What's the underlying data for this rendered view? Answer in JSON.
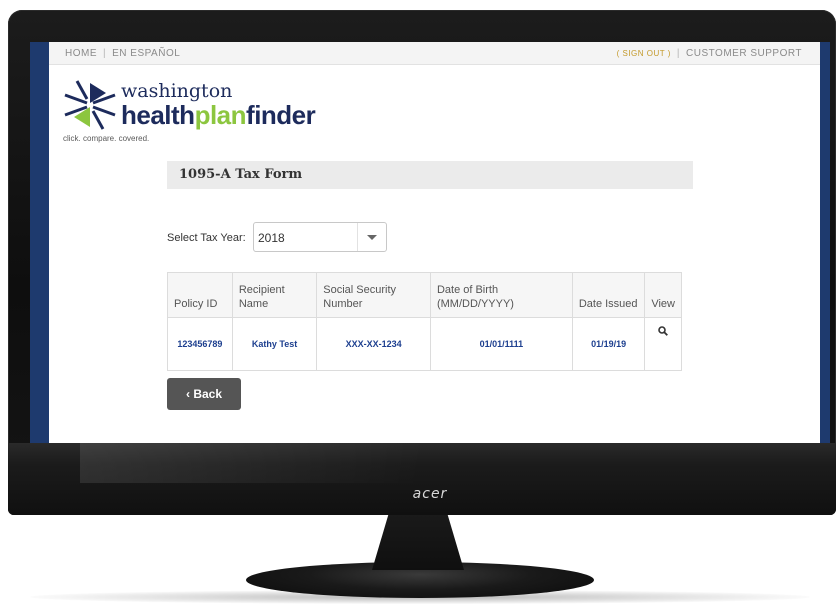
{
  "nav": {
    "home": "HOME",
    "espanol": "EN ESPAÑOL",
    "signout": "( SIGN OUT )",
    "support": "CUSTOMER SUPPORT"
  },
  "logo": {
    "line1": "washington",
    "hp_a": "health",
    "hp_b": "plan",
    "hp_c": "finder",
    "tagline": "click. compare. covered."
  },
  "page": {
    "title": "1095-A Tax Form",
    "year_label": "Select Tax Year:",
    "year_value": "2018",
    "back_label": "Back"
  },
  "table": {
    "headers": [
      "Policy ID",
      "Recipient Name",
      "Social Security Number",
      "Date of Birth (MM/DD/YYYY)",
      "Date Issued",
      "View"
    ],
    "rows": [
      [
        "123456789",
        "Kathy Test",
        "XXX-XX-1234",
        "01/01/1111",
        "01/19/19"
      ]
    ]
  },
  "monitor": {
    "brand": "acer"
  },
  "colors": {
    "navy": "#1d2b5c",
    "green": "#8cc63f",
    "link_blue": "#1d3f8f",
    "frame_blue": "#1e3a6e"
  }
}
